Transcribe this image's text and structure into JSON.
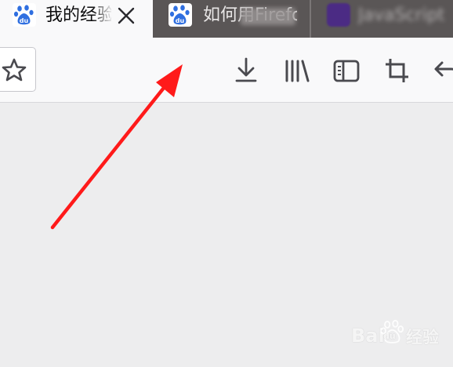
{
  "tabs": [
    {
      "title": "我的经验",
      "icon": "baidu-paw-icon",
      "active": true
    },
    {
      "title": "如何用Firefox",
      "icon": "baidu-paw-icon",
      "active": false
    },
    {
      "title": "JavaScript",
      "icon": "purple-app-icon",
      "active": false
    }
  ],
  "toolbar": {
    "buttons": [
      {
        "name": "bookmark-star",
        "icon": "star-icon"
      },
      {
        "name": "downloads",
        "icon": "download-icon"
      },
      {
        "name": "library",
        "icon": "library-icon"
      },
      {
        "name": "sidebar",
        "icon": "sidebar-icon"
      },
      {
        "name": "screenshot",
        "icon": "crop-icon"
      },
      {
        "name": "back",
        "icon": "back-arrow-icon"
      }
    ]
  },
  "watermark": {
    "brand_latin": "Bai",
    "brand_du": "du",
    "brand_cn": "经验"
  },
  "colors": {
    "tabstrip": "#5a5656",
    "toolbar": "#f9f9fa",
    "content": "#ededee",
    "icon": "#4a4a4f",
    "arrow": "#ff1a1a",
    "baidu_blue": "#2f6fe0",
    "purple_icon": "#4b2b84"
  }
}
